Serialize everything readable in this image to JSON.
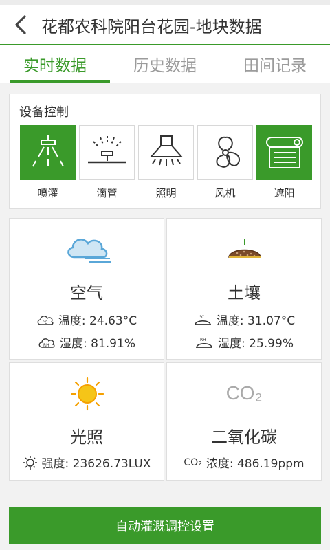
{
  "header": {
    "title": "花都农科院阳台花园-地块数据"
  },
  "tabs": [
    {
      "label": "实时数据",
      "active": true
    },
    {
      "label": "历史数据",
      "active": false
    },
    {
      "label": "田间记录",
      "active": false
    }
  ],
  "device_control": {
    "title": "设备控制",
    "devices": [
      {
        "label": "喷灌",
        "icon": "sprinkler-icon",
        "on": true
      },
      {
        "label": "滴管",
        "icon": "drip-irrigation-icon",
        "on": false
      },
      {
        "label": "照明",
        "icon": "lamp-icon",
        "on": false
      },
      {
        "label": "风机",
        "icon": "fan-icon",
        "on": false
      },
      {
        "label": "遮阳",
        "icon": "sunshade-icon",
        "on": true
      }
    ]
  },
  "sensors": {
    "air": {
      "name": "空气",
      "temperature": "温度: 24.63°C",
      "humidity": "湿度: 81.91%"
    },
    "soil": {
      "name": "土壤",
      "temperature": "温度: 31.07°C",
      "humidity": "湿度: 25.99%"
    },
    "light": {
      "name": "光照",
      "intensity": "强度: 23626.73LUX"
    },
    "co2": {
      "icon_text": "CO₂",
      "name": "二氧化碳",
      "concentration": "浓度: 486.19ppm"
    }
  },
  "actions": {
    "auto_control_label": "自动灌溉调控设置"
  },
  "colors": {
    "accent": "#3a9a2a",
    "sun": "#f5c518",
    "cloud": "#5aa7d8",
    "soil": "#7a4a2a"
  }
}
